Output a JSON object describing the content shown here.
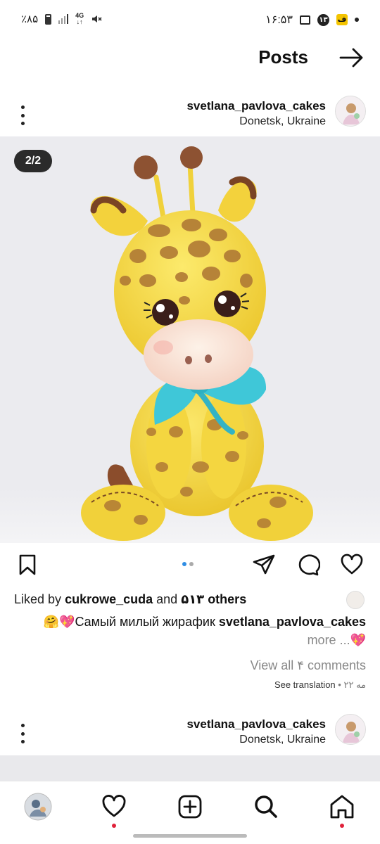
{
  "status_bar": {
    "battery": "٪۸۵",
    "network": "4G",
    "time": "۱۶:۵۳",
    "notification_count": "۱۳",
    "yellow_badge": "ف"
  },
  "header": {
    "title": "Posts"
  },
  "post": {
    "username": "svetlana_pavlova_cakes",
    "location": "Donetsk, Ukraine",
    "image_counter": "2/2",
    "current_image": 1,
    "image_total": 2,
    "liked_by_prefix": "Liked by",
    "liked_by_user": "cukrowe_cuda",
    "liked_by_and": "and",
    "liked_by_count": "۵۱۳",
    "liked_by_others": "others",
    "caption_emoji": "🤗💖",
    "caption_text": "Самый милый жирафик",
    "caption_user": "svetlana_pavlova_cakes",
    "caption_more_emoji": "💖",
    "more_label": "more ...",
    "view_comments": "View all ۴ comments",
    "see_translation": "See translation",
    "separator": "•",
    "date": "۲۲ مه"
  },
  "next_post": {
    "username": "svetlana_pavlova_cakes",
    "location": "Donetsk, Ukraine"
  },
  "colors": {
    "accent_blue": "#2f8de4",
    "notification_red": "#e0213a",
    "giraffe_yellow": "#f5dc3a",
    "bow_blue": "#3fc7d8"
  },
  "icons": {
    "save": "bookmark-icon",
    "share": "send-icon",
    "comment": "comment-icon",
    "like": "heart-icon",
    "nav": [
      "profile-avatar",
      "heart-icon",
      "add-post-icon",
      "search-icon",
      "home-icon"
    ]
  }
}
